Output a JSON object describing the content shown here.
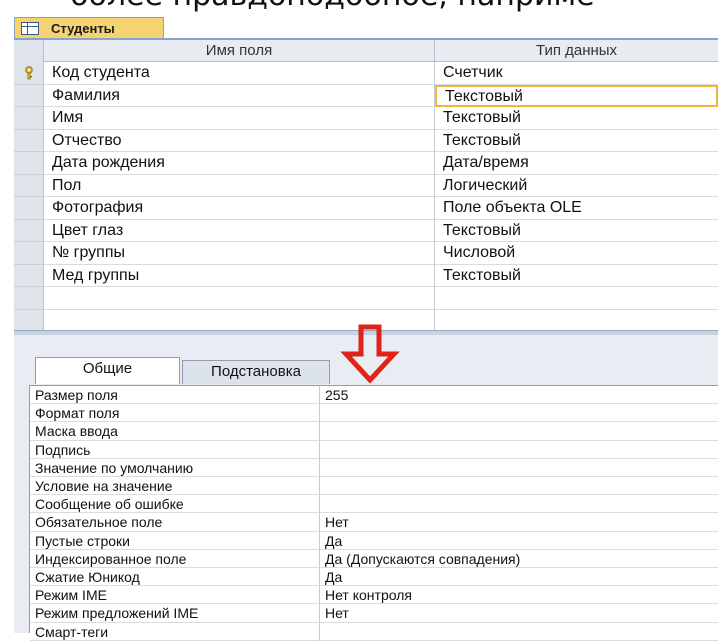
{
  "top_caption": "более правдоподобное, наприме",
  "document_tab": {
    "label": "Студенты",
    "icon": "table-icon"
  },
  "grid": {
    "headers": {
      "field_name": "Имя поля",
      "data_type": "Тип данных"
    },
    "rows": [
      {
        "name": "Код студента",
        "type": "Счетчик",
        "primary_key": true
      },
      {
        "name": "Фамилия",
        "type": "Текстовый",
        "active": true
      },
      {
        "name": "Имя",
        "type": "Текстовый"
      },
      {
        "name": "Отчество",
        "type": "Текстовый"
      },
      {
        "name": "Дата рождения",
        "type": "Дата/время"
      },
      {
        "name": "Пол",
        "type": "Логический"
      },
      {
        "name": "Фотография",
        "type": "Поле объекта OLE"
      },
      {
        "name": "Цвет глаз",
        "type": "Текстовый"
      },
      {
        "name": "№ группы",
        "type": "Числовой"
      },
      {
        "name": "Мед группы",
        "type": "Текстовый"
      },
      {
        "name": "",
        "type": ""
      },
      {
        "name": "",
        "type": ""
      }
    ]
  },
  "property_tabs": {
    "general": "Общие",
    "lookup": "Подстановка"
  },
  "properties": [
    {
      "label": "Размер поля",
      "value": "255"
    },
    {
      "label": "Формат поля",
      "value": ""
    },
    {
      "label": "Маска ввода",
      "value": ""
    },
    {
      "label": "Подпись",
      "value": ""
    },
    {
      "label": "Значение по умолчанию",
      "value": ""
    },
    {
      "label": "Условие на значение",
      "value": ""
    },
    {
      "label": "Сообщение об ошибке",
      "value": ""
    },
    {
      "label": "Обязательное поле",
      "value": "Нет"
    },
    {
      "label": "Пустые строки",
      "value": "Да"
    },
    {
      "label": "Индексированное поле",
      "value": "Да (Допускаются совпадения)"
    },
    {
      "label": "Сжатие Юникод",
      "value": "Да"
    },
    {
      "label": "Режим IME",
      "value": "Нет контроля"
    },
    {
      "label": "Режим предложений IME",
      "value": "Нет"
    },
    {
      "label": "Смарт-теги",
      "value": ""
    }
  ],
  "colors": {
    "arrow": "#e0231a",
    "tab_highlight": "#f6d372",
    "active_cell_border": "#f0b63a"
  },
  "icons": {
    "primary_key": "key-icon",
    "annotation": "down-arrow-icon"
  }
}
